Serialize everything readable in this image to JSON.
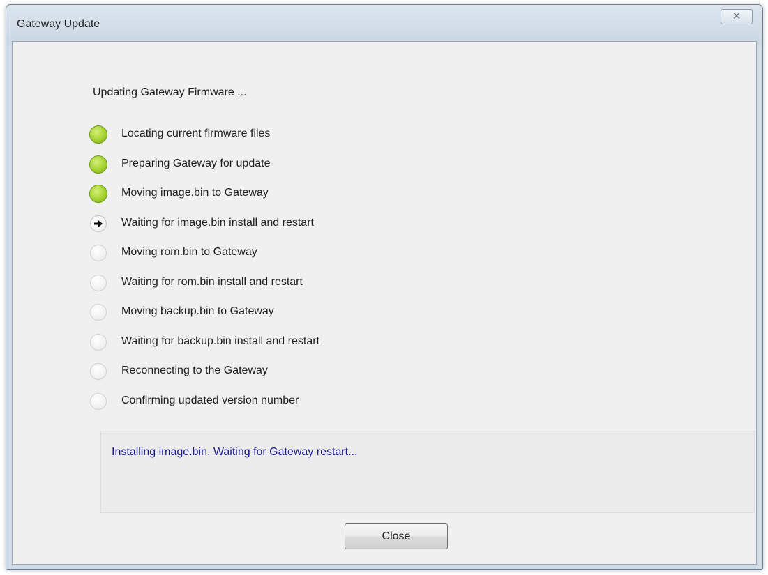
{
  "window": {
    "title": "Gateway Update",
    "close_glyph": "☒",
    "close_icon": "close-icon"
  },
  "main": {
    "heading": "Updating Gateway Firmware ...",
    "steps": [
      {
        "label": "Locating current firmware files",
        "state": "done"
      },
      {
        "label": "Preparing Gateway for update",
        "state": "done"
      },
      {
        "label": "Moving image.bin to Gateway",
        "state": "done"
      },
      {
        "label": "Waiting for image.bin install and restart",
        "state": "current"
      },
      {
        "label": "Moving rom.bin to Gateway",
        "state": "pending"
      },
      {
        "label": "Waiting for rom.bin install and restart",
        "state": "pending"
      },
      {
        "label": "Moving backup.bin to Gateway",
        "state": "pending"
      },
      {
        "label": "Waiting for backup.bin install and restart",
        "state": "pending"
      },
      {
        "label": "Reconnecting to the Gateway",
        "state": "pending"
      },
      {
        "label": "Confirming updated version number",
        "state": "pending"
      }
    ],
    "status_message": "Installing image.bin. Waiting for Gateway restart...",
    "close_label": "Close"
  },
  "colors": {
    "done": "#a4d230",
    "status_text": "#1a1a8c"
  }
}
